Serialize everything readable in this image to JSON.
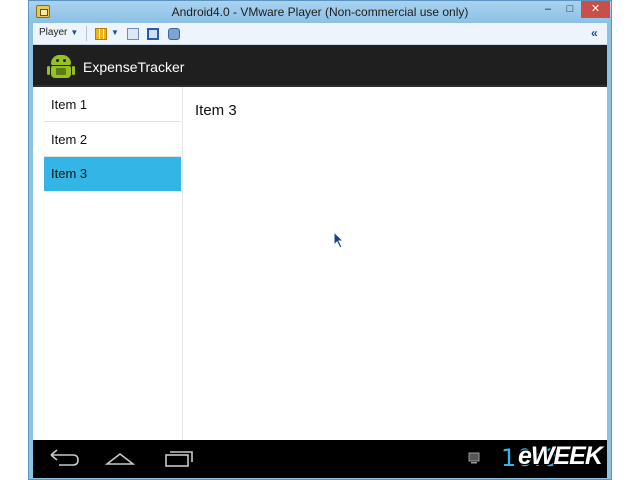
{
  "window": {
    "title": "Android4.0 - VMware Player (Non-commercial use only)",
    "minimize_label": "–",
    "maximize_label": "□",
    "close_label": "✕"
  },
  "toolbar": {
    "player_menu_label": "Player",
    "expand_label": "«"
  },
  "app": {
    "name": "ExpenseTracker"
  },
  "list": {
    "items": [
      {
        "label": "Item 1",
        "selected": false
      },
      {
        "label": "Item 2",
        "selected": false
      },
      {
        "label": "Item 3",
        "selected": true
      }
    ]
  },
  "detail": {
    "title": "Item 3"
  },
  "statusbar": {
    "clock": "10:0"
  },
  "watermark": {
    "text": "eWEEK"
  },
  "colors": {
    "selection": "#33b5e5",
    "actionbar": "#1f1f1f",
    "navbar": "#000000",
    "clock": "#33b5e5",
    "android_green": "#97c024"
  },
  "icons": [
    "app-icon",
    "player-caret-icon",
    "suspend-icon",
    "network-icon",
    "fullscreen-icon",
    "unity-icon",
    "expand-icon",
    "android-icon",
    "back-icon",
    "home-icon",
    "recents-icon",
    "screen-icon",
    "cursor-icon"
  ]
}
